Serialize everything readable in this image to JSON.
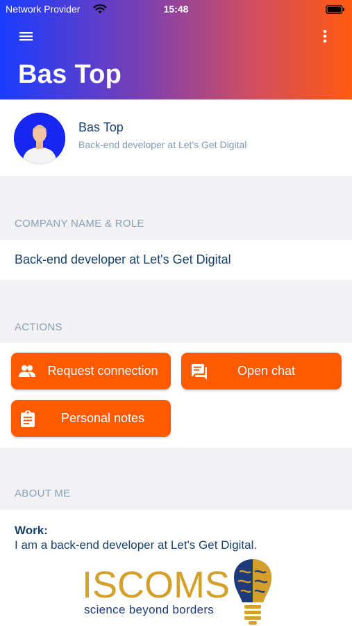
{
  "status_bar": {
    "carrier": "Network Provider",
    "time": "15:48"
  },
  "header": {
    "title": "Bas Top"
  },
  "profile": {
    "name": "Bas Top",
    "subtitle": "Back-end developer at Let's Get Digital"
  },
  "company_section": {
    "label": "COMPANY NAME & ROLE",
    "value": "Back-end developer at Let's Get Digital"
  },
  "actions_section": {
    "label": "ACTIONS",
    "request_connection": "Request connection",
    "open_chat": "Open chat",
    "personal_notes": "Personal notes"
  },
  "about_section": {
    "label": "ABOUT ME",
    "work_label": "Work:",
    "work_text": "I am a back-end developer at Let's Get Digital."
  },
  "logo": {
    "name": "ISCOMS",
    "tagline": "science beyond borders"
  },
  "colors": {
    "accent": "#ff5a00",
    "text_dark": "#17406b",
    "text_muted": "#8aa0b5"
  }
}
